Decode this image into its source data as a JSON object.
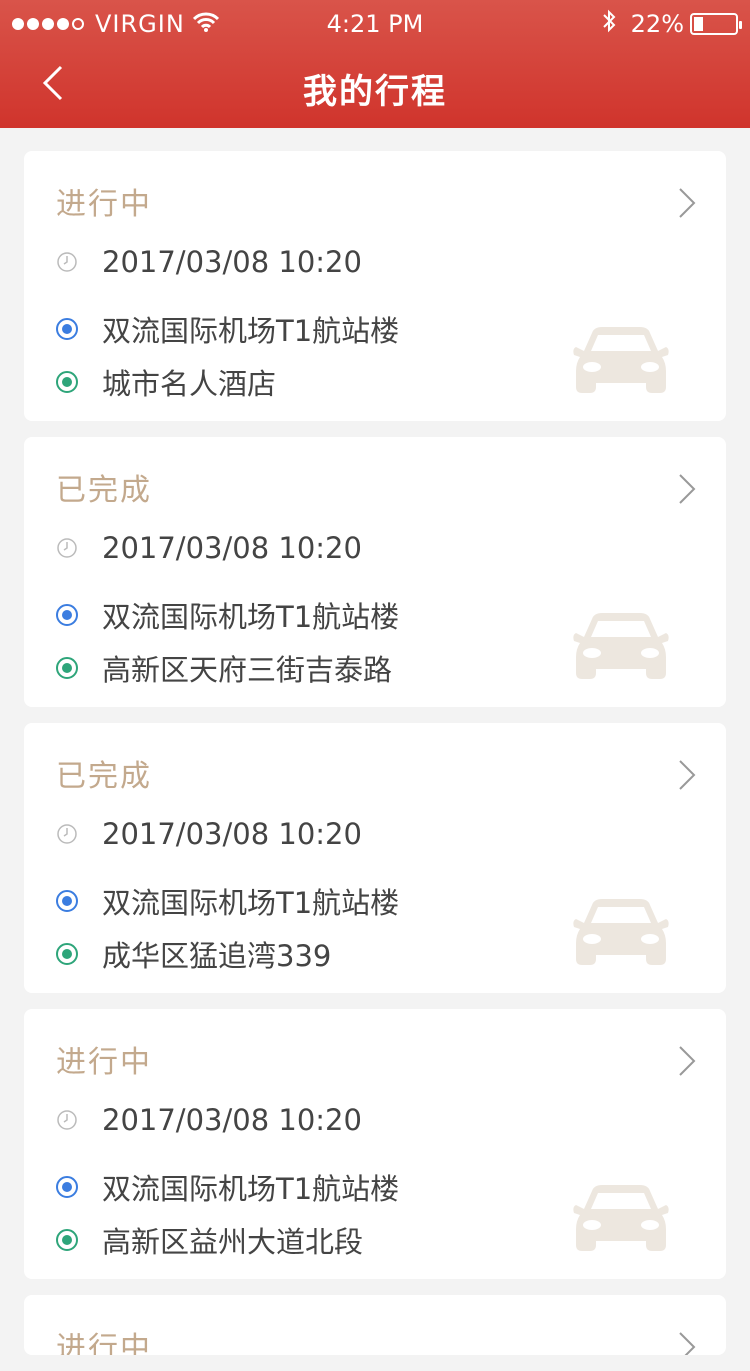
{
  "status_bar": {
    "carrier": "VIRGIN",
    "time": "4:21 PM",
    "battery": "22%",
    "battery_level": 0.22
  },
  "nav": {
    "title": "我的行程"
  },
  "trips": [
    {
      "status": "进行中",
      "time": "2017/03/08 10:20",
      "from": "双流国际机场T1航站楼",
      "to": "城市名人酒店"
    },
    {
      "status": "已完成",
      "time": "2017/03/08 10:20",
      "from": "双流国际机场T1航站楼",
      "to": "高新区天府三街吉泰路"
    },
    {
      "status": "已完成",
      "time": "2017/03/08 10:20",
      "from": "双流国际机场T1航站楼",
      "to": "成华区猛追湾339"
    },
    {
      "status": "进行中",
      "time": "2017/03/08 10:20",
      "from": "双流国际机场T1航站楼",
      "to": "高新区益州大道北段"
    },
    {
      "status": "进行中"
    }
  ],
  "colors": {
    "header": "#d0342c",
    "status_text": "#c3a98d",
    "from_dot": "#3b7de0",
    "to_dot": "#2ea57a",
    "car_icon": "#ede7df"
  },
  "icons": [
    "back-arrow-icon",
    "wifi-icon",
    "bluetooth-icon",
    "battery-icon",
    "chevron-right-icon",
    "clock-icon",
    "origin-dot-icon",
    "destination-dot-icon",
    "car-icon"
  ]
}
